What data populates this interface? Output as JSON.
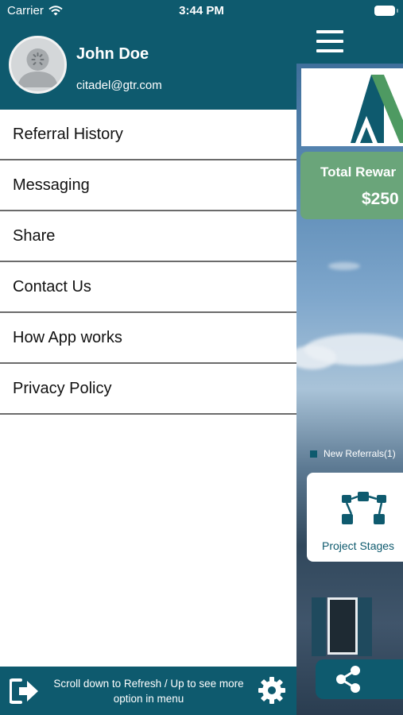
{
  "status_bar": {
    "carrier": "Carrier",
    "time": "3:44 PM"
  },
  "drawer": {
    "user": {
      "name": "John Doe",
      "email": "citadel@gtr.com"
    },
    "menu_items": [
      {
        "label": "Referral History"
      },
      {
        "label": "Messaging"
      },
      {
        "label": "Share"
      },
      {
        "label": "Contact Us"
      },
      {
        "label": "How App works"
      },
      {
        "label": "Privacy Policy"
      }
    ],
    "footer_hint": "Scroll down to Refresh / Up to see more option in menu",
    "icons": {
      "logout": "logout-icon",
      "settings": "gear-icon",
      "avatar": "user-avatar-icon"
    }
  },
  "background_app": {
    "rewards_title": "Total Rewar",
    "rewards_amount": "$250",
    "legend_label": "New Referrals(1)",
    "stage_card_label": "Project Stages",
    "icons": {
      "menu": "hamburger-icon",
      "stages": "flow-icon",
      "share": "share-icon"
    }
  },
  "colors": {
    "primary": "#0e5a6e",
    "rewards_green": "#6aa57a",
    "logo_green": "#4e9a62",
    "logo_teal": "#0e5a6e"
  }
}
